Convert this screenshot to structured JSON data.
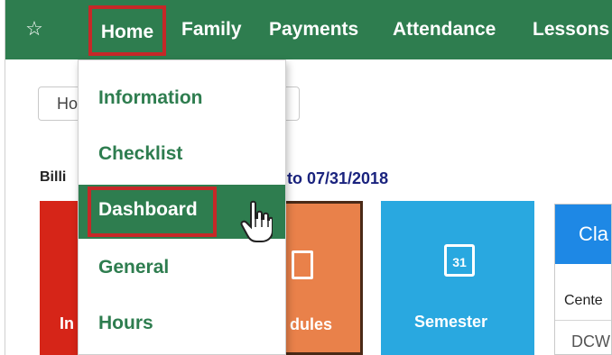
{
  "nav": {
    "star_icon": "star-icon",
    "items": [
      "Home",
      "Family",
      "Payments",
      "Attendance",
      "Lessons"
    ]
  },
  "dropdown": {
    "items": [
      "Information",
      "Checklist",
      "Dashboard",
      "General",
      "Hours"
    ]
  },
  "search": {
    "visible_text": "Ho"
  },
  "billing": {
    "label": "Billi",
    "range": "to 07/31/2018"
  },
  "tiles": {
    "red": "In",
    "orange": "dules",
    "blue": "Semester",
    "blue_calendar_day": "31"
  },
  "panel": {
    "header": "Cla",
    "sub": "Cente",
    "row": "DCW"
  },
  "colors": {
    "primary_green": "#2e7d4f",
    "highlight_red": "#c62828",
    "tile_red": "#d62518",
    "tile_orange": "#e9814a",
    "tile_blue": "#29a8e0"
  }
}
